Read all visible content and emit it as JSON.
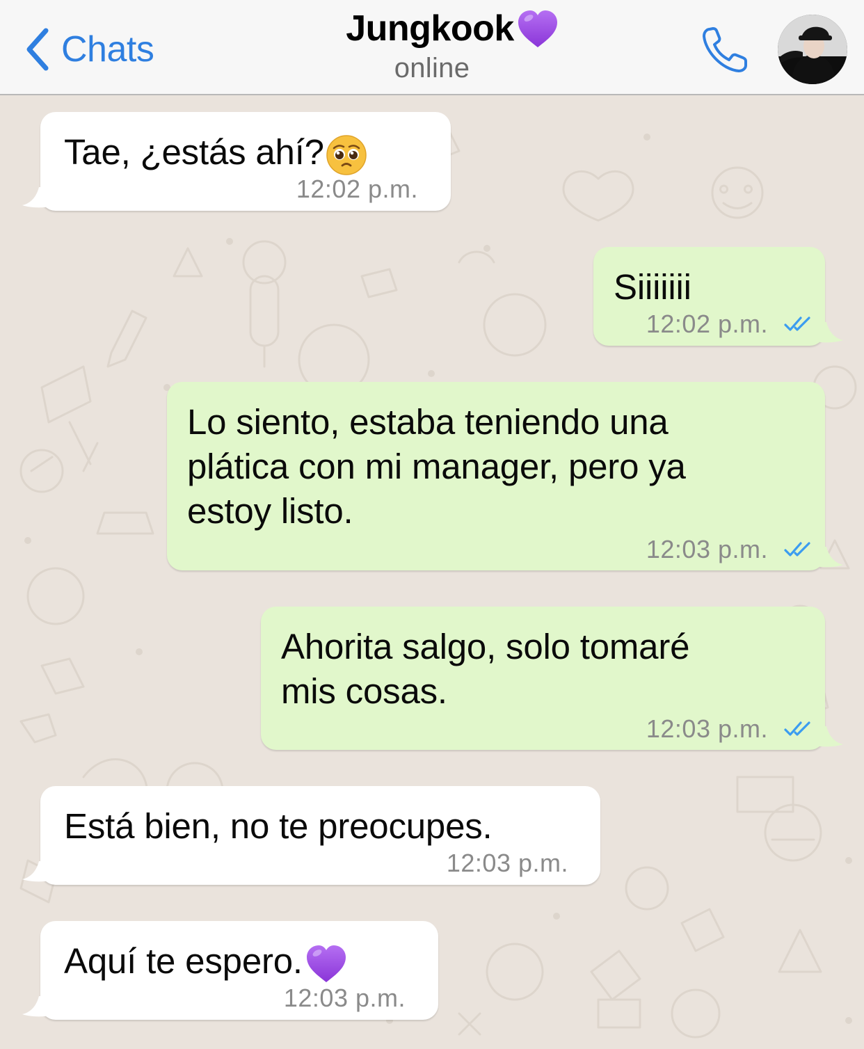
{
  "header": {
    "back_label": "Chats",
    "contact_name": "Jungkook",
    "contact_name_emoji": "purple-heart",
    "status": "online"
  },
  "colors": {
    "accent_blue": "#2f7fe0",
    "incoming_bubble": "#ffffff",
    "outgoing_bubble": "#e1f7cb",
    "read_ticks": "#3b9cf0",
    "purple_heart": "#9b4fe0"
  },
  "messages": [
    {
      "direction": "in",
      "text": "Tae, ¿estás ahí?",
      "emoji": "pleading-face",
      "time": "12:02 p.m."
    },
    {
      "direction": "out",
      "text": "Siiiiiii",
      "time": "12:02 p.m.",
      "read": true
    },
    {
      "direction": "out",
      "lines": [
        "Lo siento, estaba teniendo una",
        "plática con mi manager, pero ya",
        "estoy listo."
      ],
      "time": "12:03 p.m.",
      "read": true
    },
    {
      "direction": "out",
      "lines": [
        "Ahorita salgo, solo tomaré",
        "mis cosas."
      ],
      "time": "12:03 p.m.",
      "read": true
    },
    {
      "direction": "in",
      "text": "Está bien, no te preocupes.",
      "time": "12:03 p.m."
    },
    {
      "direction": "in",
      "text": "Aquí te espero.",
      "emoji": "purple-heart",
      "time": "12:03 p.m."
    }
  ]
}
